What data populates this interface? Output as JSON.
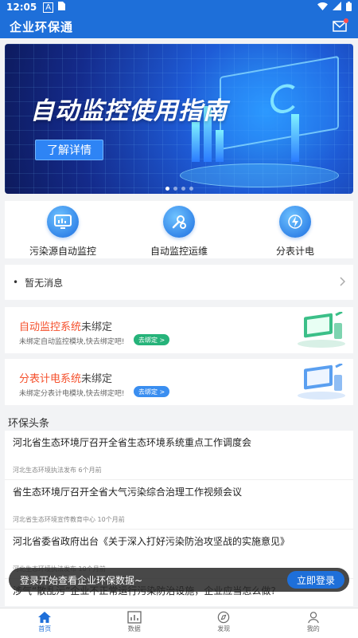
{
  "status_bar": {
    "time": "12:05"
  },
  "header": {
    "title": "企业环保通"
  },
  "banner": {
    "title": "自动监控使用指南",
    "button_label": "了解详情"
  },
  "quick_actions": [
    {
      "label": "污染源自动监控",
      "icon": "monitor-icon"
    },
    {
      "label": "自动监控运维",
      "icon": "wrench-gear-icon"
    },
    {
      "label": "分表计电",
      "icon": "lightning-icon"
    }
  ],
  "notice": {
    "text": "暂无消息"
  },
  "bind_cards": [
    {
      "system": "自动监控系统",
      "status": "未绑定",
      "desc": "未绑定自动监控模块,快去绑定吧!",
      "button": "去绑定 >",
      "button_color": "#26b37a"
    },
    {
      "system": "分表计电系统",
      "status": "未绑定",
      "desc": "未绑定分表计电模块,快去绑定吧!",
      "button": "去绑定 >",
      "button_color": "#3a8ef0"
    }
  ],
  "news_section": {
    "title": "环保头条"
  },
  "news": [
    {
      "title": "河北省生态环境厅召开全省生态环境系统重点工作调度会",
      "source": "河北生态环境执法发布",
      "time": "6个月前"
    },
    {
      "title": "省生态环境厅召开全省大气污染综合治理工作视频会议",
      "source": "河北省生态环境宣传教育中心",
      "time": "10个月前"
    },
    {
      "title": "河北省委省政府出台《关于深入打好污染防治攻坚战的实施意见》",
      "source": "河北生态环境执法发布",
      "time": "10个月前"
    },
    {
      "title": "涉气“散乱污”企业不正常运行污染防治设施，企业应当怎么做?",
      "source": "",
      "time": ""
    }
  ],
  "toast": {
    "text": "登录开始查看企业环保数据~",
    "button": "立即登录"
  },
  "tabs": [
    {
      "label": "首页",
      "icon": "home-icon",
      "active": true
    },
    {
      "label": "数据",
      "icon": "chart-icon",
      "active": false
    },
    {
      "label": "发现",
      "icon": "compass-icon",
      "active": false
    },
    {
      "label": "我的",
      "icon": "user-icon",
      "active": false
    }
  ],
  "colors": {
    "primary": "#1e6fd9",
    "accent_orange": "#f5502c"
  }
}
